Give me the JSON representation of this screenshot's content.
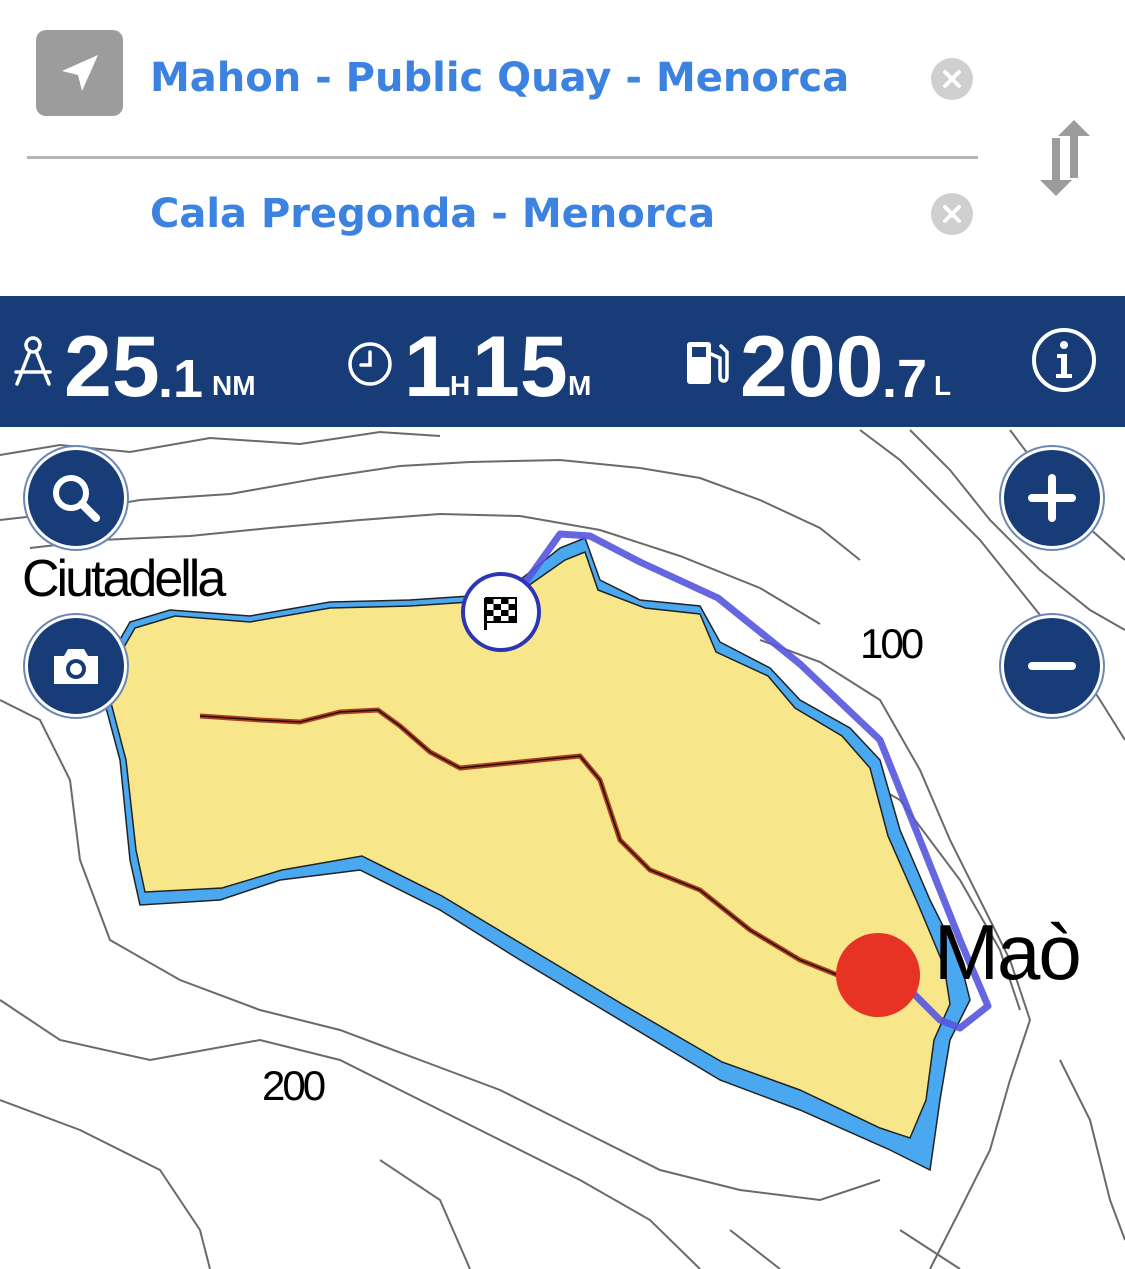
{
  "route": {
    "origin": "Mahon - Public Quay - Menorca",
    "destination": "Cala Pregonda - Menorca"
  },
  "stats": {
    "distance": {
      "whole": "25",
      "fraction": ".1",
      "unit": "NM"
    },
    "time": {
      "hours": "1",
      "hours_unit": "H",
      "minutes": "15",
      "minutes_unit": "M"
    },
    "fuel": {
      "whole": "200",
      "fraction": ".7",
      "unit": "L"
    }
  },
  "map": {
    "labels": {
      "west_town": "Ciutadella",
      "east_town": "Maò",
      "depth_100": "100",
      "depth_200": "200"
    }
  },
  "icons": {
    "locate": "navigation-arrow-icon",
    "clear": "clear-x-icon",
    "swap": "swap-arrows-icon",
    "distance": "compass-icon",
    "time": "clock-icon",
    "fuel": "fuel-pump-icon",
    "info": "info-icon",
    "search": "search-icon",
    "camera": "camera-icon",
    "zoom_in": "plus-icon",
    "zoom_out": "minus-icon",
    "destination": "checkered-flag-icon"
  },
  "colors": {
    "accent": "#3c82e0",
    "bar": "#173c78",
    "land": "#f7e78a",
    "shallow": "#4aa8f0",
    "route": "#5555dd",
    "origin": "#e63323"
  }
}
